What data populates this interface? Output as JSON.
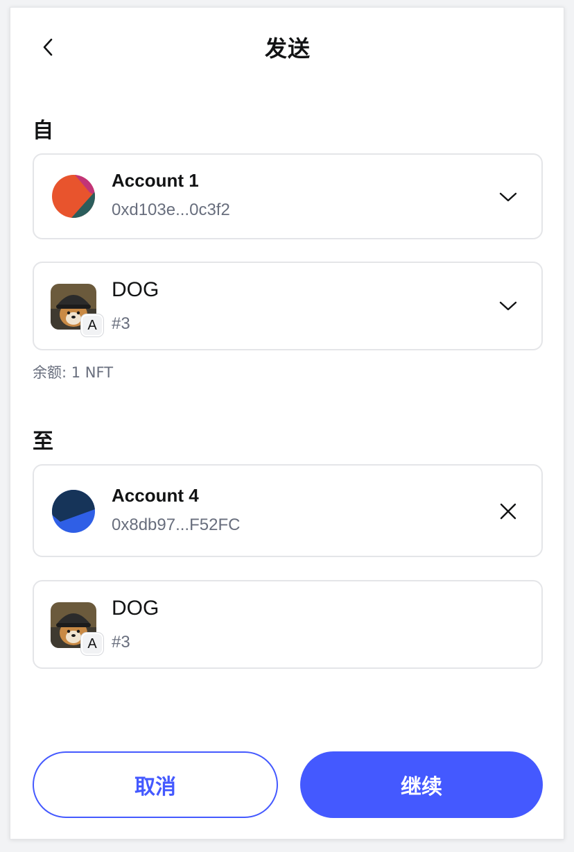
{
  "header": {
    "title": "发送",
    "back_icon": "chevron-left-icon"
  },
  "from": {
    "label": "自",
    "account": {
      "name": "Account 1",
      "address": "0xd103e...0c3f2",
      "trailing_icon": "chevron-down-icon"
    },
    "asset": {
      "name": "DOG",
      "token_id": "#3",
      "badge": "A",
      "trailing_icon": "chevron-down-icon"
    },
    "balance": "余额: 1 NFT"
  },
  "to": {
    "label": "至",
    "account": {
      "name": "Account 4",
      "address": "0x8db97...F52FC",
      "trailing_icon": "close-icon"
    },
    "asset": {
      "name": "DOG",
      "token_id": "#3",
      "badge": "A"
    }
  },
  "actions": {
    "cancel_label": "取消",
    "continue_label": "继续"
  },
  "colors": {
    "primary": "#4459ff",
    "text_muted": "#686e7d",
    "border": "#e4e5e8"
  }
}
